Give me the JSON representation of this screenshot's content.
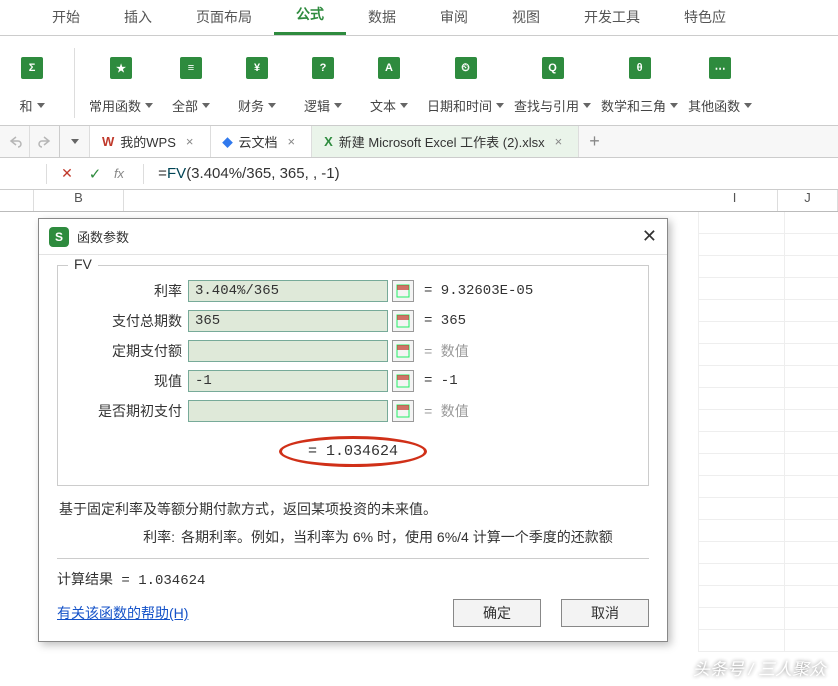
{
  "ribbon": {
    "tabs": [
      "开始",
      "插入",
      "页面布局",
      "公式",
      "数据",
      "审阅",
      "视图",
      "开发工具",
      "特色应"
    ],
    "active_index": 3,
    "groups": [
      {
        "icon": "Σ",
        "label": "和"
      },
      {
        "icon": "★",
        "label": "常用函数"
      },
      {
        "icon": "≡",
        "label": "全部"
      },
      {
        "icon": "¥",
        "label": "财务"
      },
      {
        "icon": "?",
        "label": "逻辑"
      },
      {
        "icon": "A",
        "label": "文本"
      },
      {
        "icon": "⏲",
        "label": "日期和时间"
      },
      {
        "icon": "Q",
        "label": "查找与引用"
      },
      {
        "icon": "θ",
        "label": "数学和三角"
      },
      {
        "icon": "⋯",
        "label": "其他函数"
      }
    ]
  },
  "doc_tabs": {
    "items": [
      {
        "icon": "W",
        "icon_color": "#c0392b",
        "label": "我的WPS"
      },
      {
        "icon": "◆",
        "icon_color": "#3079ed",
        "label": "云文档"
      },
      {
        "icon": "X",
        "icon_color": "#2e8b3e",
        "label": "新建 Microsoft Excel 工作表 (2).xlsx"
      }
    ],
    "active_index": 2
  },
  "formula_bar": {
    "fn": "FV",
    "args": "(3.404%/365, 365, , -1)",
    "full": "=FV(3.404%/365, 365, , -1)"
  },
  "columns": {
    "B": "B",
    "I": "I",
    "J": "J"
  },
  "dialog": {
    "title": "函数参数",
    "fn": "FV",
    "params": [
      {
        "label": "利率",
        "value": "3.404%/365",
        "result": "= 9.32603E-05"
      },
      {
        "label": "支付总期数",
        "value": "365",
        "result": "= 365"
      },
      {
        "label": "定期支付额",
        "value": "",
        "result": "= 数值",
        "gray": true
      },
      {
        "label": "现值",
        "value": "-1",
        "result": "= -1"
      },
      {
        "label": "是否期初支付",
        "value": "",
        "result": "= 数值",
        "gray": true
      }
    ],
    "big_result": "= 1.034624",
    "desc_main": "基于固定利率及等额分期付款方式，返回某项投资的未来值。",
    "desc_key": "利率:",
    "desc_val": "各期利率。例如，当利率为 6% 时，使用 6%/4 计算一个季度的还款额",
    "calc_result": "计算结果 = 1.034624",
    "help": "有关该函数的帮助(H)",
    "ok": "确定",
    "cancel": "取消"
  },
  "cell_formula": "=FV(3.404%/365, 365, , -1)",
  "watermark": "头条号 / 三人聚众"
}
